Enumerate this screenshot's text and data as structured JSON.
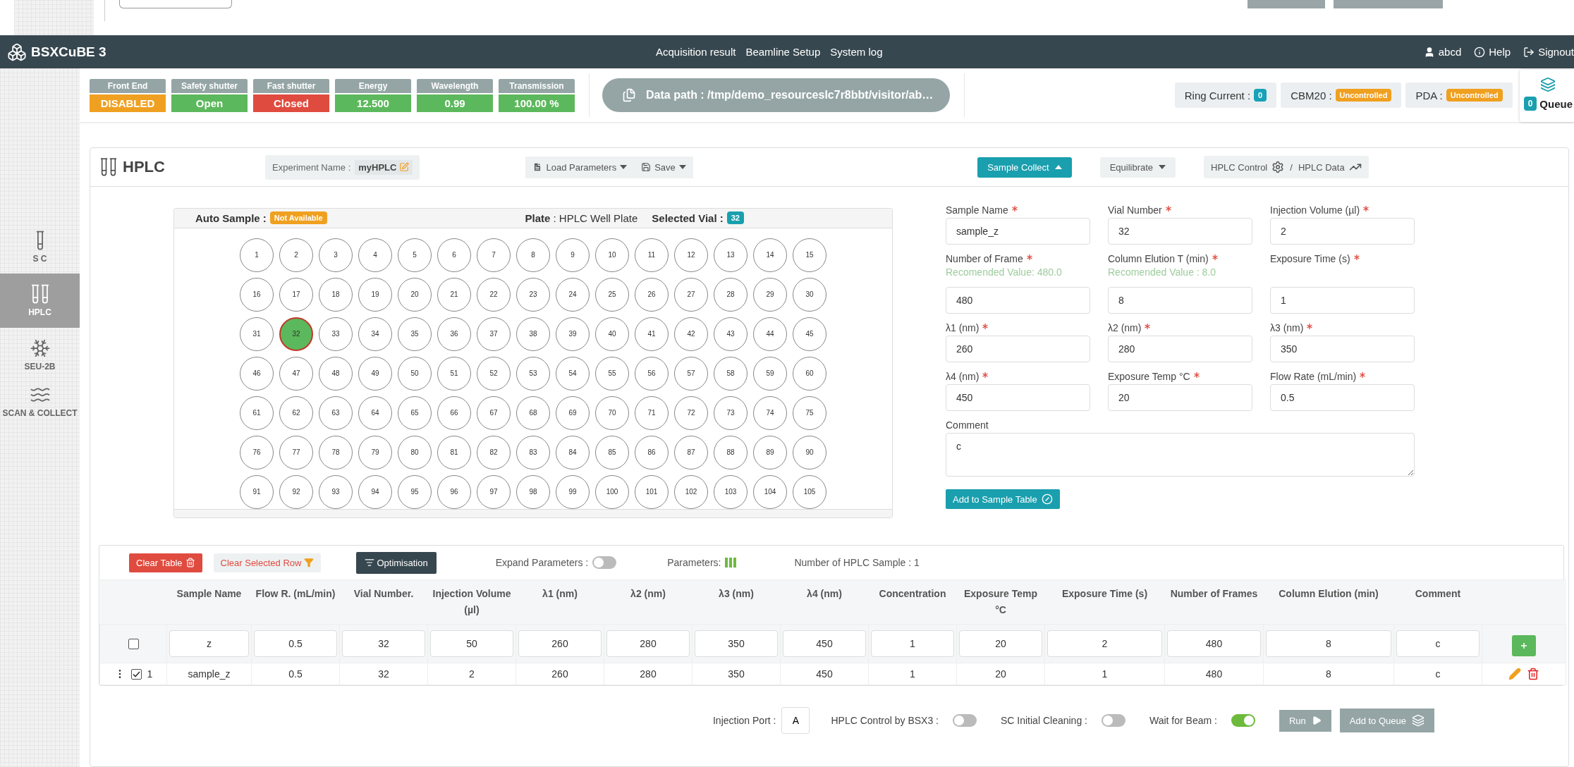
{
  "navbar": {
    "title": "BSXCuBE 3",
    "links": [
      "Acquisition result",
      "Beamline Setup",
      "System log"
    ],
    "user": "abcd",
    "help": "Help",
    "signout": "Signout"
  },
  "sidebar": {
    "items": [
      {
        "label": "S C",
        "kind": "sc",
        "selected": false
      },
      {
        "label": "HPLC",
        "kind": "hplc",
        "selected": true
      },
      {
        "label": "SEU-2B",
        "kind": "seu",
        "selected": false
      },
      {
        "label": "SCAN & COLLECT",
        "kind": "scan",
        "selected": false
      }
    ]
  },
  "status": {
    "indicators": [
      {
        "label": "Front End",
        "value": "DISABLED",
        "color": "#f0a020"
      },
      {
        "label": "Safety shutter",
        "value": "Open",
        "color": "#5cb85c"
      },
      {
        "label": "Fast shutter",
        "value": "Closed",
        "color": "#e04b3f"
      },
      {
        "label": "Energy",
        "value": "12.500",
        "color": "#5cb85c"
      },
      {
        "label": "Wavelength",
        "value": "0.99",
        "color": "#5cb85c"
      },
      {
        "label": "Transmission",
        "value": "100.00 %",
        "color": "#5cb85c"
      }
    ],
    "data_path": "Data path : /tmp/demo_resourceslc7r8bbt/visitor/ab…",
    "devices": [
      {
        "label": "Ring Current :",
        "value": "0",
        "color": "#17a2b8"
      },
      {
        "label": "CBM20 :",
        "value": "Uncontrolled",
        "color": "#f0a020"
      },
      {
        "label": "PDA :",
        "value": "Uncontrolled",
        "color": "#f0a020"
      }
    ],
    "queue": {
      "count": "0",
      "label": "Queue"
    }
  },
  "card": {
    "title": "HPLC",
    "experiment_label": "Experiment Name :",
    "experiment_name": "myHPLC",
    "load_button": "Load Parameters",
    "save_button": "Save",
    "tabs": [
      {
        "label": "Sample Collect",
        "kind": "dropdown",
        "selected": true
      },
      {
        "label": "Equilibrate",
        "kind": "dropdown",
        "selected": false
      },
      {
        "label": "HPLC Control",
        "kind": "control",
        "selected": false
      },
      {
        "label": "HPLC Data",
        "kind": "data",
        "selected": false
      }
    ],
    "tab_separator": "/"
  },
  "plate": {
    "auto_sample_label": "Auto Sample :",
    "auto_sample_badge": "Not Available",
    "plate_label": "Plate",
    "plate_value": ": HPLC Well Plate",
    "selected_vial_label": "Selected Vial :",
    "selected_vial": "32",
    "vials": [
      {
        "label": "1",
        "selected": false
      },
      {
        "label": "2",
        "selected": false
      },
      {
        "label": "3",
        "selected": false
      },
      {
        "label": "4",
        "selected": false
      },
      {
        "label": "5",
        "selected": false
      },
      {
        "label": "6",
        "selected": false
      },
      {
        "label": "7",
        "selected": false
      },
      {
        "label": "8",
        "selected": false
      },
      {
        "label": "9",
        "selected": false
      },
      {
        "label": "10",
        "selected": false
      },
      {
        "label": "11",
        "selected": false
      },
      {
        "label": "12",
        "selected": false
      },
      {
        "label": "13",
        "selected": false
      },
      {
        "label": "14",
        "selected": false
      },
      {
        "label": "15",
        "selected": false
      },
      {
        "label": "16",
        "selected": false
      },
      {
        "label": "17",
        "selected": false
      },
      {
        "label": "18",
        "selected": false
      },
      {
        "label": "19",
        "selected": false
      },
      {
        "label": "20",
        "selected": false
      },
      {
        "label": "21",
        "selected": false
      },
      {
        "label": "22",
        "selected": false
      },
      {
        "label": "23",
        "selected": false
      },
      {
        "label": "24",
        "selected": false
      },
      {
        "label": "25",
        "selected": false
      },
      {
        "label": "26",
        "selected": false
      },
      {
        "label": "27",
        "selected": false
      },
      {
        "label": "28",
        "selected": false
      },
      {
        "label": "29",
        "selected": false
      },
      {
        "label": "30",
        "selected": false
      },
      {
        "label": "31",
        "selected": false
      },
      {
        "label": "32",
        "selected": true
      },
      {
        "label": "33",
        "selected": false
      },
      {
        "label": "34",
        "selected": false
      },
      {
        "label": "35",
        "selected": false
      },
      {
        "label": "36",
        "selected": false
      },
      {
        "label": "37",
        "selected": false
      },
      {
        "label": "38",
        "selected": false
      },
      {
        "label": "39",
        "selected": false
      },
      {
        "label": "40",
        "selected": false
      },
      {
        "label": "41",
        "selected": false
      },
      {
        "label": "42",
        "selected": false
      },
      {
        "label": "43",
        "selected": false
      },
      {
        "label": "44",
        "selected": false
      },
      {
        "label": "45",
        "selected": false
      },
      {
        "label": "46",
        "selected": false
      },
      {
        "label": "47",
        "selected": false
      },
      {
        "label": "48",
        "selected": false
      },
      {
        "label": "49",
        "selected": false
      },
      {
        "label": "50",
        "selected": false
      },
      {
        "label": "51",
        "selected": false
      },
      {
        "label": "52",
        "selected": false
      },
      {
        "label": "53",
        "selected": false
      },
      {
        "label": "54",
        "selected": false
      },
      {
        "label": "55",
        "selected": false
      },
      {
        "label": "56",
        "selected": false
      },
      {
        "label": "57",
        "selected": false
      },
      {
        "label": "58",
        "selected": false
      },
      {
        "label": "59",
        "selected": false
      },
      {
        "label": "60",
        "selected": false
      },
      {
        "label": "61",
        "selected": false
      },
      {
        "label": "62",
        "selected": false
      },
      {
        "label": "63",
        "selected": false
      },
      {
        "label": "64",
        "selected": false
      },
      {
        "label": "65",
        "selected": false
      },
      {
        "label": "66",
        "selected": false
      },
      {
        "label": "67",
        "selected": false
      },
      {
        "label": "68",
        "selected": false
      },
      {
        "label": "69",
        "selected": false
      },
      {
        "label": "70",
        "selected": false
      },
      {
        "label": "71",
        "selected": false
      },
      {
        "label": "72",
        "selected": false
      },
      {
        "label": "73",
        "selected": false
      },
      {
        "label": "74",
        "selected": false
      },
      {
        "label": "75",
        "selected": false
      },
      {
        "label": "76",
        "selected": false
      },
      {
        "label": "77",
        "selected": false
      },
      {
        "label": "78",
        "selected": false
      },
      {
        "label": "79",
        "selected": false
      },
      {
        "label": "80",
        "selected": false
      },
      {
        "label": "81",
        "selected": false
      },
      {
        "label": "82",
        "selected": false
      },
      {
        "label": "83",
        "selected": false
      },
      {
        "label": "84",
        "selected": false
      },
      {
        "label": "85",
        "selected": false
      },
      {
        "label": "86",
        "selected": false
      },
      {
        "label": "87",
        "selected": false
      },
      {
        "label": "88",
        "selected": false
      },
      {
        "label": "89",
        "selected": false
      },
      {
        "label": "90",
        "selected": false
      },
      {
        "label": "91",
        "selected": false
      },
      {
        "label": "92",
        "selected": false
      },
      {
        "label": "93",
        "selected": false
      },
      {
        "label": "94",
        "selected": false
      },
      {
        "label": "95",
        "selected": false
      },
      {
        "label": "96",
        "selected": false
      },
      {
        "label": "97",
        "selected": false
      },
      {
        "label": "98",
        "selected": false
      },
      {
        "label": "99",
        "selected": false
      },
      {
        "label": "100",
        "selected": false
      },
      {
        "label": "101",
        "selected": false
      },
      {
        "label": "102",
        "selected": false
      },
      {
        "label": "103",
        "selected": false
      },
      {
        "label": "104",
        "selected": false
      },
      {
        "label": "105",
        "selected": false
      }
    ]
  },
  "form": {
    "fields": [
      {
        "label": "Sample Name",
        "required": true,
        "value": "sample_z",
        "kind": "input"
      },
      {
        "label": "Vial Number",
        "required": true,
        "value": "32",
        "kind": "input"
      },
      {
        "label": "Injection Volume (µl)",
        "required": true,
        "value": "2",
        "kind": "input"
      },
      {
        "label": "Number of Frame",
        "required": true,
        "hint": "Recomended Value: 480.0",
        "value": "480",
        "kind": "input"
      },
      {
        "label": "Column Elution T (min)",
        "required": true,
        "hint": "Recomended Value : 8.0",
        "value": "8",
        "kind": "input"
      },
      {
        "label": "Exposure Time (s)",
        "required": true,
        "value": "1",
        "kind": "input"
      },
      {
        "label": "λ1 (nm)",
        "required": true,
        "value": "260",
        "kind": "input"
      },
      {
        "label": "λ2 (nm)",
        "required": true,
        "value": "280",
        "kind": "input"
      },
      {
        "label": "λ3 (nm)",
        "required": true,
        "value": "350",
        "kind": "input"
      },
      {
        "label": "λ4 (nm)",
        "required": true,
        "value": "450",
        "kind": "input"
      },
      {
        "label": "Exposure Temp °C",
        "required": true,
        "value": "20",
        "kind": "input"
      },
      {
        "label": "Flow Rate (mL/min)",
        "required": true,
        "value": "0.5",
        "kind": "input"
      },
      {
        "label": "Comment",
        "required": false,
        "value": "c",
        "kind": "textarea"
      }
    ],
    "add_button": "Add to Sample Table"
  },
  "table": {
    "clear_table": "Clear Table",
    "clear_selected": "Clear Selected Row",
    "optimisation": "Optimisation",
    "expand_label": "Expand Parameters :",
    "expand_on": false,
    "parameters_label": "Parameters:",
    "sample_count": "Number of HPLC Sample : 1",
    "columns": [
      "Sample Name",
      "Flow R. (mL/min)",
      "Vial Number.",
      "Injection Volume (µl)",
      "λ1 (nm)",
      "λ2 (nm)",
      "λ3 (nm)",
      "λ4 (nm)",
      "Concentration",
      "Exposure Temp °C",
      "Exposure Time (s)",
      "Number of Frames",
      "Column Elution (min)",
      "Comment"
    ],
    "rows": [
      {
        "kind": "input",
        "checked": false,
        "cells": [
          "z",
          "0.5",
          "32",
          "50",
          "260",
          "280",
          "350",
          "450",
          "1",
          "20",
          "2",
          "480",
          "8",
          "c"
        ]
      },
      {
        "kind": "data",
        "checked": true,
        "index": "1",
        "cells": [
          "sample_z",
          "0.5",
          "32",
          "2",
          "260",
          "280",
          "350",
          "450",
          "1",
          "20",
          "1",
          "480",
          "8",
          "c"
        ]
      }
    ]
  },
  "footer": {
    "injection_port_label": "Injection Port :",
    "injection_port": "A",
    "toggles": [
      {
        "label": "HPLC Control by BSX3 :",
        "on": false
      },
      {
        "label": "SC Initial Cleaning :",
        "on": false
      },
      {
        "label": "Wait for Beam :",
        "on": true
      }
    ],
    "run_button": "Run",
    "queue_button": "Add to Queue"
  }
}
